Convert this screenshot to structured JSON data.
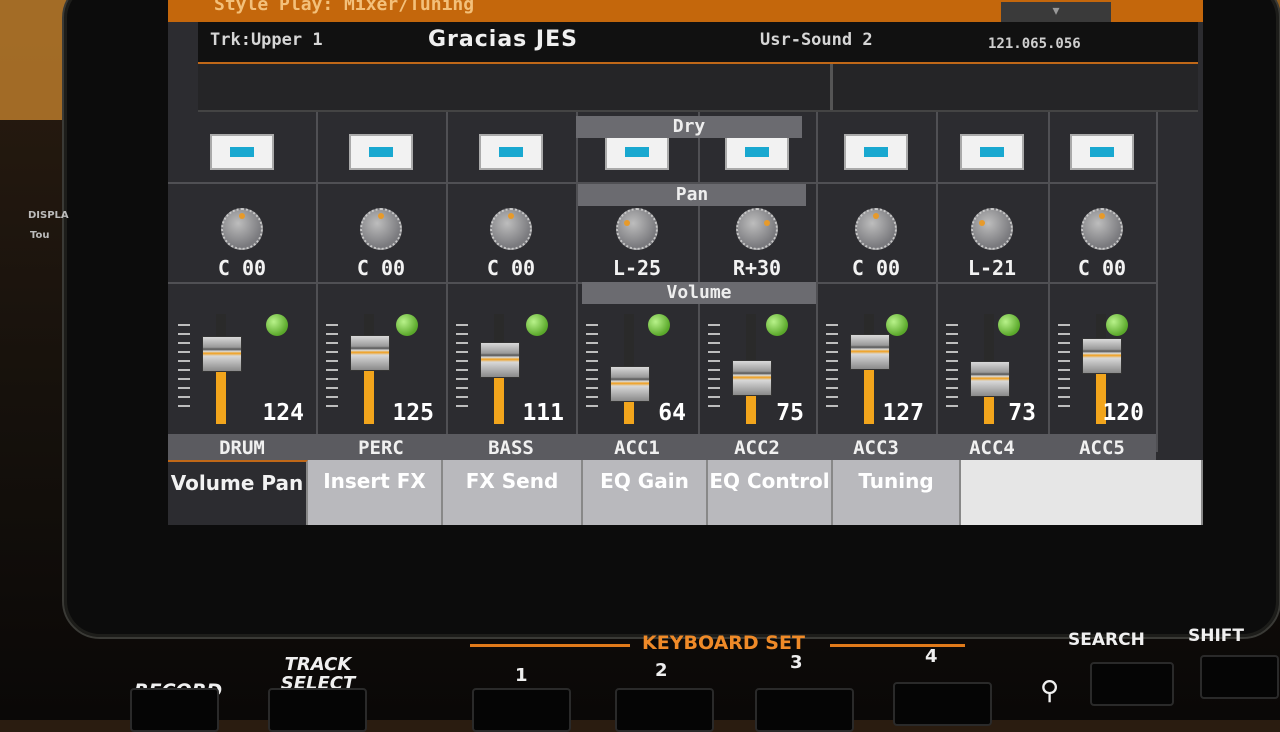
{
  "screen": {
    "title": "Style Play: Mixer/Tuning",
    "track": "Trk:Upper 1",
    "song": "Gracias JES",
    "sound": "Usr-Sound 2",
    "tempo": "121.065.056"
  },
  "sections": {
    "dry": "Dry",
    "pan": "Pan",
    "volume": "Volume"
  },
  "channels": [
    {
      "name": "DRUM",
      "pan": "C 00",
      "volume": 124
    },
    {
      "name": "PERC",
      "pan": "C 00",
      "volume": 125
    },
    {
      "name": "BASS",
      "pan": "C 00",
      "volume": 111
    },
    {
      "name": "ACC1",
      "pan": "L-25",
      "volume": 64
    },
    {
      "name": "ACC2",
      "pan": "R+30",
      "volume": 75
    },
    {
      "name": "ACC3",
      "pan": "C 00",
      "volume": 127
    },
    {
      "name": "ACC4",
      "pan": "L-21",
      "volume": 73
    },
    {
      "name": "ACC5",
      "pan": "C 00",
      "volume": 120
    }
  ],
  "tabs": [
    {
      "label": "Volume Pan",
      "active": true
    },
    {
      "label": "Insert FX",
      "active": false
    },
    {
      "label": "FX Send",
      "active": false
    },
    {
      "label": "EQ Gain",
      "active": false
    },
    {
      "label": "EQ Control",
      "active": false
    },
    {
      "label": "Tuning",
      "active": false
    }
  ],
  "panel": {
    "record": "RECORD",
    "track_select": "TRACK SELECT",
    "keyboard_set": "KEYBOARD SET",
    "kb_numbers": [
      "1",
      "2",
      "3",
      "4"
    ],
    "search": "SEARCH",
    "shift": "SHIFT",
    "display": "DISPLA",
    "touch": "Tou"
  },
  "colors": {
    "accent": "#c4670c",
    "fader_fill": "#f2a51c",
    "led_green": "#5aa82a",
    "dry_led": "#19a8d0"
  }
}
